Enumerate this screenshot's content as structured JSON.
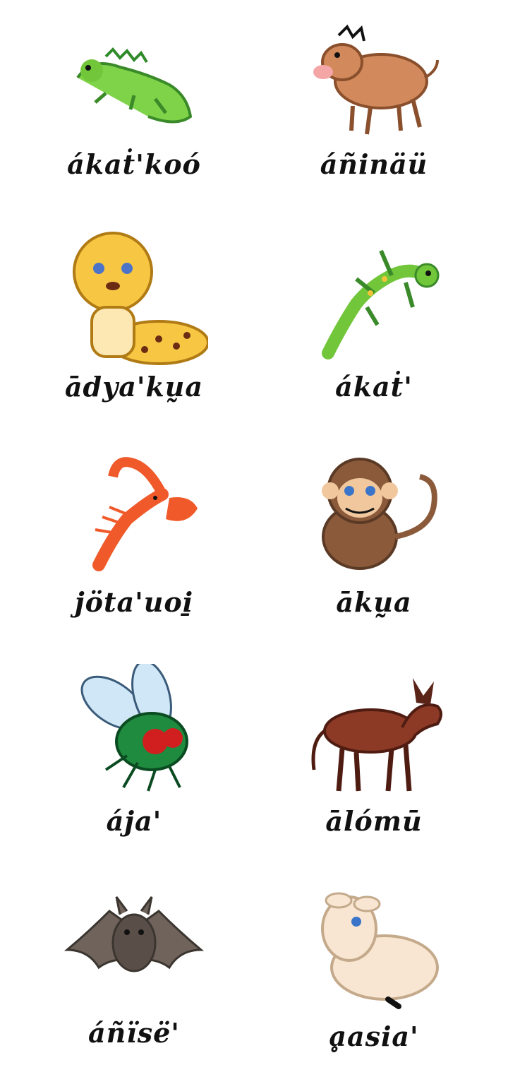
{
  "animals": [
    {
      "name": "iguana",
      "label": "ákaṫ'koó"
    },
    {
      "name": "warthog",
      "label": "áñinäü"
    },
    {
      "name": "cheetah",
      "label": "ādya'kṵa"
    },
    {
      "name": "gecko",
      "label": "ákaṫ'"
    },
    {
      "name": "crayfish",
      "label": "jöta'uoi̱"
    },
    {
      "name": "monkey",
      "label": "ākṵa"
    },
    {
      "name": "fly",
      "label": "ája'"
    },
    {
      "name": "donkey",
      "label": "ālómū"
    },
    {
      "name": "bat",
      "label": "áñïsë'"
    },
    {
      "name": "lamb",
      "label": "ḁasia'"
    }
  ]
}
